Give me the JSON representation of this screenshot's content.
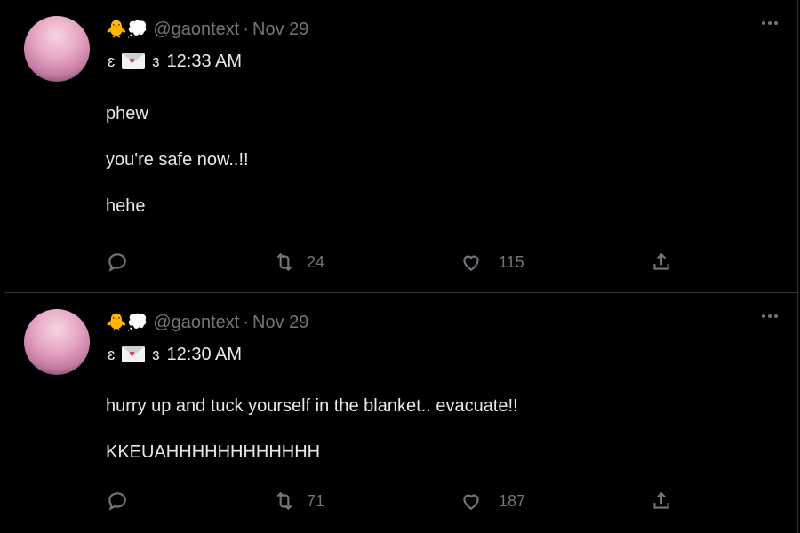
{
  "tweets": [
    {
      "handle": "@gaontext",
      "date": "Nov 29",
      "header_emoji": "🐥💭",
      "display_name": {
        "left_paren": "ɛ",
        "right_paren": "ɜ",
        "time": "12:33 AM"
      },
      "text": "phew\n\nyou're safe now..!!\n\nhehe",
      "retweets": "24",
      "likes": "115",
      "icons": [
        "reply-icon",
        "retweet-icon",
        "like-icon",
        "share-icon",
        "more-icon"
      ]
    },
    {
      "handle": "@gaontext",
      "date": "Nov 29",
      "header_emoji": "🐥💭",
      "display_name": {
        "left_paren": "ɛ",
        "right_paren": "ɜ",
        "time": "12:30 AM"
      },
      "text": "hurry up and tuck yourself in the blanket.. evacuate!!\n\nKKEUAHHHHHHHHHHHH",
      "retweets": "71",
      "likes": "187",
      "icons": [
        "reply-icon",
        "retweet-icon",
        "like-icon",
        "share-icon",
        "more-icon"
      ]
    }
  ],
  "colors": {
    "background": "#000000",
    "text": "#e7e9ea",
    "muted": "#71767b",
    "divider": "#2f3336"
  }
}
